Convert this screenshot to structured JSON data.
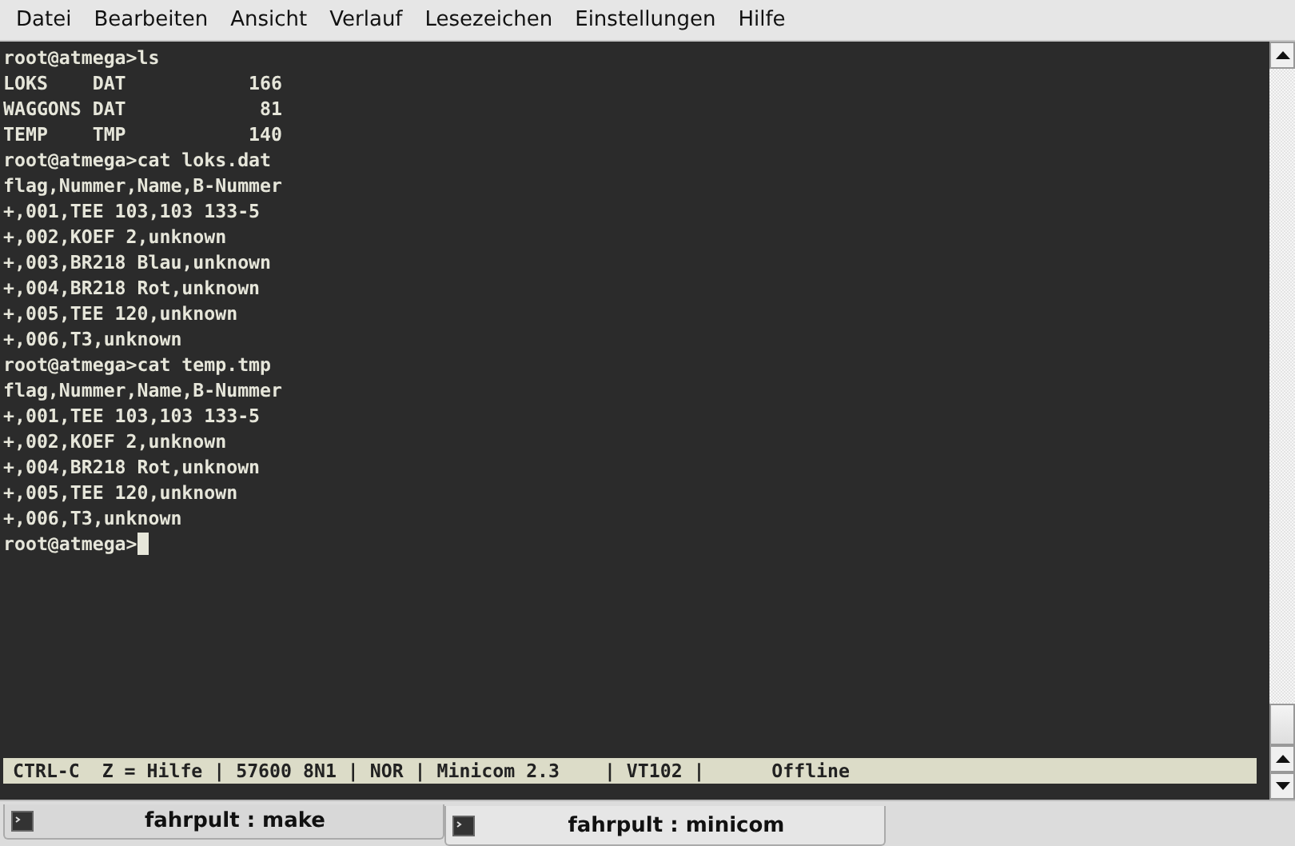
{
  "menu": [
    "Datei",
    "Bearbeiten",
    "Ansicht",
    "Verlauf",
    "Lesezeichen",
    "Einstellungen",
    "Hilfe"
  ],
  "terminal": {
    "lines": [
      "root@atmega>ls",
      "LOKS    DAT           166",
      "WAGGONS DAT            81",
      "TEMP    TMP           140",
      "root@atmega>cat loks.dat",
      "flag,Nummer,Name,B-Nummer",
      "+,001,TEE 103,103 133-5",
      "+,002,KOEF 2,unknown",
      "+,003,BR218 Blau,unknown",
      "+,004,BR218 Rot,unknown",
      "+,005,TEE 120,unknown",
      "+,006,T3,unknown",
      "root@atmega>cat temp.tmp",
      "flag,Nummer,Name,B-Nummer",
      "+,001,TEE 103,103 133-5",
      "+,002,KOEF 2,unknown",
      "+,004,BR218 Rot,unknown",
      "+,005,TEE 120,unknown",
      "+,006,T3,unknown",
      "root@atmega>"
    ],
    "cursor": true,
    "status_line": "CTRL-C  Z = Hilfe | 57600 8N1 | NOR | Minicom 2.3    | VT102 |      Offline"
  },
  "tabs": [
    {
      "label": "fahrpult : make",
      "selected": false
    },
    {
      "label": "fahrpult : minicom",
      "selected": true
    }
  ]
}
